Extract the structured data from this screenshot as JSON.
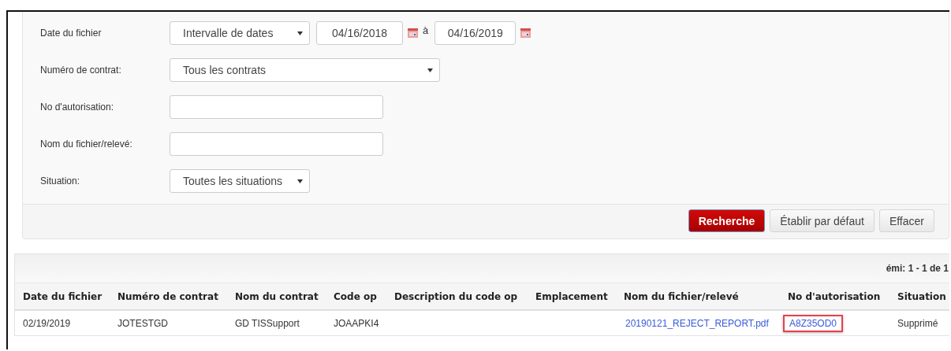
{
  "filters": [
    {
      "kind": "daterange",
      "label": "Date du fichier",
      "select": "Intervalle de dates",
      "from": "04/16/2018",
      "separator": "à",
      "to": "04/16/2019"
    },
    {
      "kind": "select",
      "label": "Numéro de contrat:",
      "value": "Tous les contrats"
    },
    {
      "kind": "text",
      "label": "No d'autorisation:"
    },
    {
      "kind": "text",
      "label": "Nom du fichier/relevé:"
    },
    {
      "kind": "select",
      "label": "Situation:",
      "value": "Toutes les situations"
    }
  ],
  "buttons": [
    {
      "label": "Recherche",
      "primary": true
    },
    {
      "label": "Établir par défaut",
      "primary": false
    },
    {
      "label": "Effacer",
      "primary": false
    }
  ],
  "results": {
    "count": "émi: 1 - 1 de 1",
    "columns": [
      "Date du fichier",
      "Numéro de contrat",
      "Nom du contrat",
      "Code op",
      "Description du code op",
      "Emplacement",
      "Nom du fichier/relevé",
      "No d'autorisation",
      "Situation"
    ],
    "rows": [
      {
        "cells": [
          {
            "text": "02/19/2019",
            "kind": "plain"
          },
          {
            "text": "JOTESTGD",
            "kind": "plain"
          },
          {
            "text": "GD TISSupport",
            "kind": "plain"
          },
          {
            "text": "JOAAPKI4",
            "kind": "plain"
          },
          {
            "text": "",
            "kind": "plain"
          },
          {
            "text": "",
            "kind": "plain"
          },
          {
            "text": "20190121_REJECT_REPORT.pdf",
            "kind": "link",
            "highlighted": false
          },
          {
            "text": "A8Z35OD0",
            "kind": "link",
            "highlighted": true
          },
          {
            "text": "Supprimé",
            "kind": "plain"
          }
        ]
      }
    ]
  }
}
